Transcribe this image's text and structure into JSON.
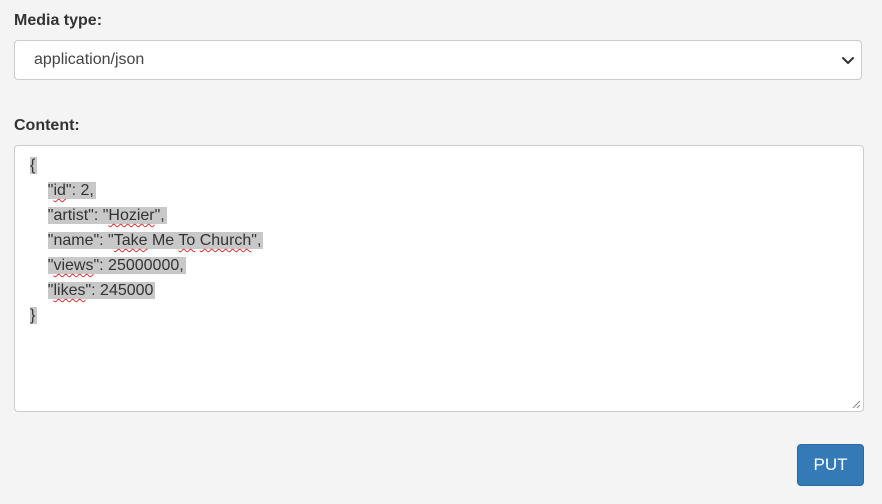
{
  "media_type": {
    "label": "Media type:",
    "selected": "application/json",
    "chevron_icon": "chevron-down-icon"
  },
  "content": {
    "label": "Content:",
    "lines": [
      {
        "indent": "",
        "parts": [
          {
            "t": "{",
            "spell": false
          }
        ]
      },
      {
        "indent": "    ",
        "parts": [
          {
            "t": "\"",
            "spell": false
          },
          {
            "t": "id",
            "spell": true
          },
          {
            "t": "\": 2,",
            "spell": false
          }
        ]
      },
      {
        "indent": "    ",
        "parts": [
          {
            "t": "\"artist\": \"",
            "spell": false
          },
          {
            "t": "Hozier",
            "spell": true
          },
          {
            "t": "\",",
            "spell": false
          }
        ]
      },
      {
        "indent": "    ",
        "parts": [
          {
            "t": "\"name\": \"",
            "spell": false
          },
          {
            "t": "Take",
            "spell": true
          },
          {
            "t": " Me ",
            "spell": false
          },
          {
            "t": "To",
            "spell": true
          },
          {
            "t": " ",
            "spell": false
          },
          {
            "t": "Church",
            "spell": true
          },
          {
            "t": "\",",
            "spell": false
          }
        ]
      },
      {
        "indent": "    ",
        "parts": [
          {
            "t": "\"",
            "spell": false
          },
          {
            "t": "views",
            "spell": true
          },
          {
            "t": "\": 25000000,",
            "spell": false
          }
        ]
      },
      {
        "indent": "    ",
        "parts": [
          {
            "t": "\"",
            "spell": false
          },
          {
            "t": "likes",
            "spell": true
          },
          {
            "t": "\": 245000",
            "spell": false
          }
        ]
      },
      {
        "indent": "",
        "parts": [
          {
            "t": "}",
            "spell": false
          }
        ]
      }
    ]
  },
  "actions": {
    "put_label": "PUT",
    "accent_color": "#337ab7"
  }
}
